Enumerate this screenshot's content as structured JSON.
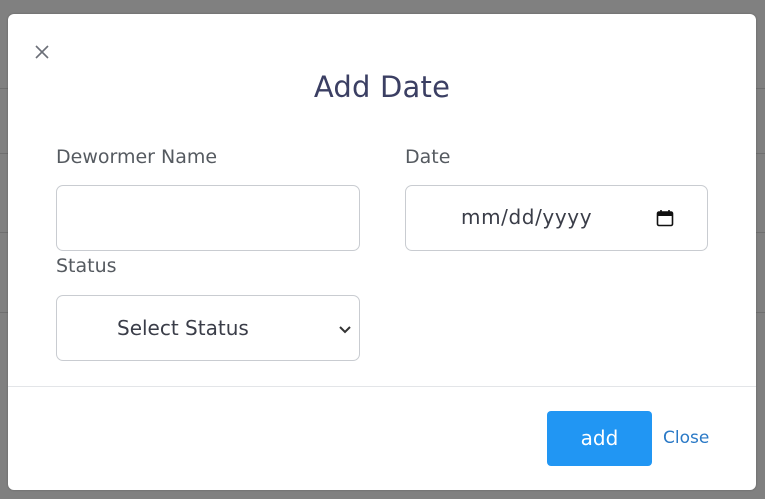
{
  "modal": {
    "title": "Add Date",
    "fields": {
      "dewormer_name": {
        "label": "Dewormer Name",
        "value": ""
      },
      "date": {
        "label": "Date",
        "placeholder": "mm/dd/yyyy"
      },
      "status": {
        "label": "Status",
        "selected": "Select Status"
      }
    },
    "footer": {
      "add_label": "add",
      "close_label": "Close"
    }
  },
  "colors": {
    "accent": "#2196f3",
    "title": "#3b3f63",
    "link": "#2a79c6",
    "overlay": "#808080"
  },
  "icons": {
    "close": "close-icon",
    "calendar": "calendar-icon",
    "dropdown": "chevron-down-icon"
  }
}
